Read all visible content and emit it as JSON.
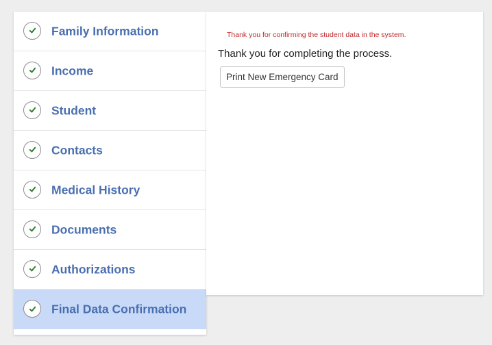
{
  "sidebar": {
    "items": [
      {
        "label": "Family Information",
        "icon": "check-icon",
        "completed": true,
        "active": false
      },
      {
        "label": "Income",
        "icon": "check-icon",
        "completed": true,
        "active": false
      },
      {
        "label": "Student",
        "icon": "check-icon",
        "completed": true,
        "active": false
      },
      {
        "label": "Contacts",
        "icon": "check-icon",
        "completed": true,
        "active": false
      },
      {
        "label": "Medical History",
        "icon": "check-icon",
        "completed": true,
        "active": false
      },
      {
        "label": "Documents",
        "icon": "check-icon",
        "completed": true,
        "active": false
      },
      {
        "label": "Authorizations",
        "icon": "check-icon",
        "completed": true,
        "active": false
      },
      {
        "label": "Final Data Confirmation",
        "icon": "check-icon",
        "completed": true,
        "active": true
      }
    ]
  },
  "content": {
    "confirmation_message": "Thank you for confirming the student data in the system.",
    "completion_message": "Thank you for completing the process.",
    "print_button_label": "Print New Emergency Card"
  },
  "colors": {
    "page_background": "#eeeeee",
    "link_blue": "#4a6fb0",
    "check_green": "#2e7d32",
    "alert_red": "#c0292b",
    "active_highlight": "#c9daf8"
  }
}
